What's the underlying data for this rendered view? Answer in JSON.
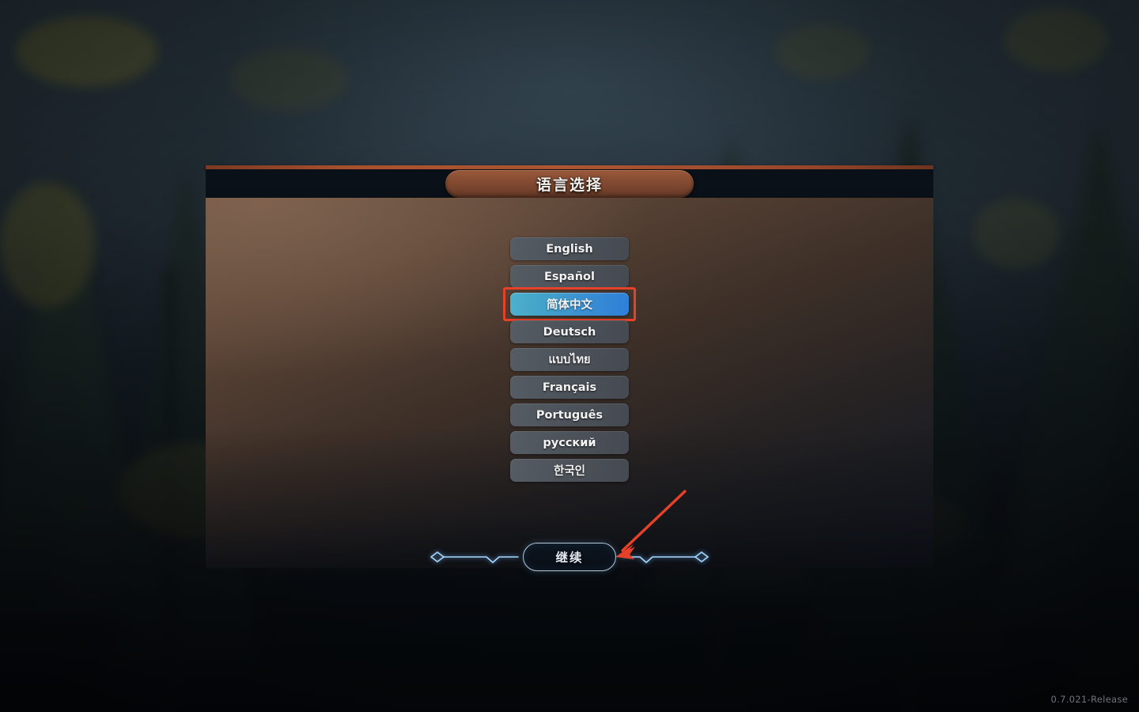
{
  "window": {
    "title": "语言选择",
    "version": "0.7.021-Release"
  },
  "language_list": {
    "name": "language-options",
    "selected_index": 2,
    "options": [
      {
        "label": "English",
        "code": "en"
      },
      {
        "label": "Español",
        "code": "es"
      },
      {
        "label": "简体中文",
        "code": "zh-CN"
      },
      {
        "label": "Deutsch",
        "code": "de"
      },
      {
        "label": "แบบไทย",
        "code": "th"
      },
      {
        "label": "Français",
        "code": "fr"
      },
      {
        "label": "Português",
        "code": "pt"
      },
      {
        "label": "русский",
        "code": "ru"
      },
      {
        "label": "한국인",
        "code": "ko"
      }
    ]
  },
  "footer": {
    "continue_label": "继续"
  },
  "annotation": {
    "arrow_color": "#e8412a",
    "highlight_color": "#e8412a",
    "arrow_points_to": "continue-button",
    "highlight_target": "简体中文"
  },
  "colors": {
    "accent_selected_left": "#4fb0cc",
    "accent_selected_right": "#2e7fd8",
    "button_idle": "#4d535a",
    "title_banner": "#8a4f34",
    "title_rail": "#b05734",
    "panel_top": "#6a5141",
    "panel_bottom": "#12161c",
    "ornament_glow": "#9ed3ff",
    "version_text": "#6d747c"
  }
}
